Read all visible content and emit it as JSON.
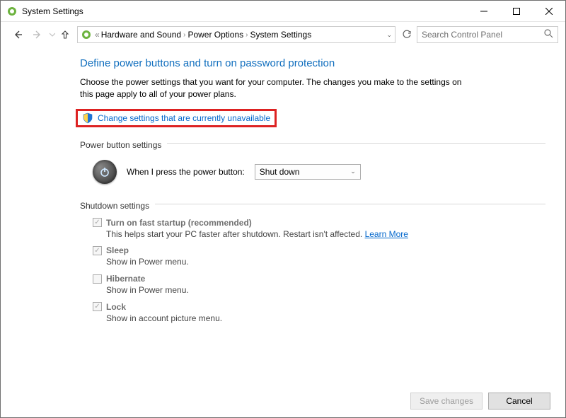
{
  "window": {
    "title": "System Settings"
  },
  "breadcrumb": {
    "lead": "«",
    "items": [
      "Hardware and Sound",
      "Power Options",
      "System Settings"
    ]
  },
  "search": {
    "placeholder": "Search Control Panel"
  },
  "page": {
    "heading": "Define power buttons and turn on password protection",
    "intro": "Choose the power settings that you want for your computer. The changes you make to the settings on this page apply to all of your power plans.",
    "change_link": "Change settings that are currently unavailable"
  },
  "power_button": {
    "section_label": "Power button settings",
    "label": "When I press the power button:",
    "value": "Shut down"
  },
  "shutdown": {
    "section_label": "Shutdown settings",
    "items": [
      {
        "checked": true,
        "label": "Turn on fast startup (recommended)",
        "desc": "This helps start your PC faster after shutdown. Restart isn't affected. ",
        "link": "Learn More"
      },
      {
        "checked": true,
        "label": "Sleep",
        "desc": "Show in Power menu."
      },
      {
        "checked": false,
        "label": "Hibernate",
        "desc": "Show in Power menu."
      },
      {
        "checked": true,
        "label": "Lock",
        "desc": "Show in account picture menu."
      }
    ]
  },
  "footer": {
    "save": "Save changes",
    "cancel": "Cancel"
  }
}
